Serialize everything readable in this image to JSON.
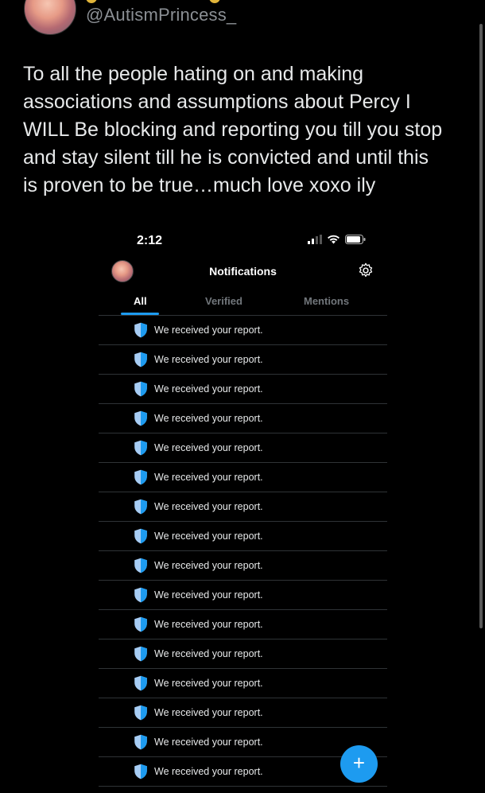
{
  "tweet": {
    "handle": "@AutismPrincess_",
    "text": "To all the people hating on and making\nassociations and assumptions about Percy I\nWILL Be blocking and reporting you till you stop\nand stay silent till he is convicted and until this\nis proven to be true…much love xoxo ily"
  },
  "phone": {
    "time": "2:12",
    "title": "Notifications",
    "tabs": [
      {
        "label": "All",
        "active": true
      },
      {
        "label": "Verified",
        "active": false
      },
      {
        "label": "Mentions",
        "active": false
      }
    ],
    "notifications": [
      {
        "text": "We received your report.",
        "icon": "shield-icon"
      },
      {
        "text": "We received your report.",
        "icon": "shield-icon"
      },
      {
        "text": "We received your report.",
        "icon": "shield-icon"
      },
      {
        "text": "We received your report.",
        "icon": "shield-icon"
      },
      {
        "text": "We received your report.",
        "icon": "shield-icon"
      },
      {
        "text": "We received your report.",
        "icon": "shield-icon"
      },
      {
        "text": "We received your report.",
        "icon": "shield-icon"
      },
      {
        "text": "We received your report.",
        "icon": "shield-icon"
      },
      {
        "text": "We received your report.",
        "icon": "shield-icon"
      },
      {
        "text": "We received your report.",
        "icon": "shield-icon"
      },
      {
        "text": "We received your report.",
        "icon": "shield-icon"
      },
      {
        "text": "We received your report.",
        "icon": "shield-icon"
      },
      {
        "text": "We received your report.",
        "icon": "shield-icon"
      },
      {
        "text": "We received your report.",
        "icon": "shield-icon"
      },
      {
        "text": "We received your report.",
        "icon": "shield-icon"
      },
      {
        "text": "We received your report.",
        "icon": "shield-icon"
      }
    ],
    "fab_label": "+"
  },
  "colors": {
    "accent": "#1d9bf0",
    "background": "#000000",
    "text": "#e7e9ea",
    "muted": "#71767b"
  }
}
